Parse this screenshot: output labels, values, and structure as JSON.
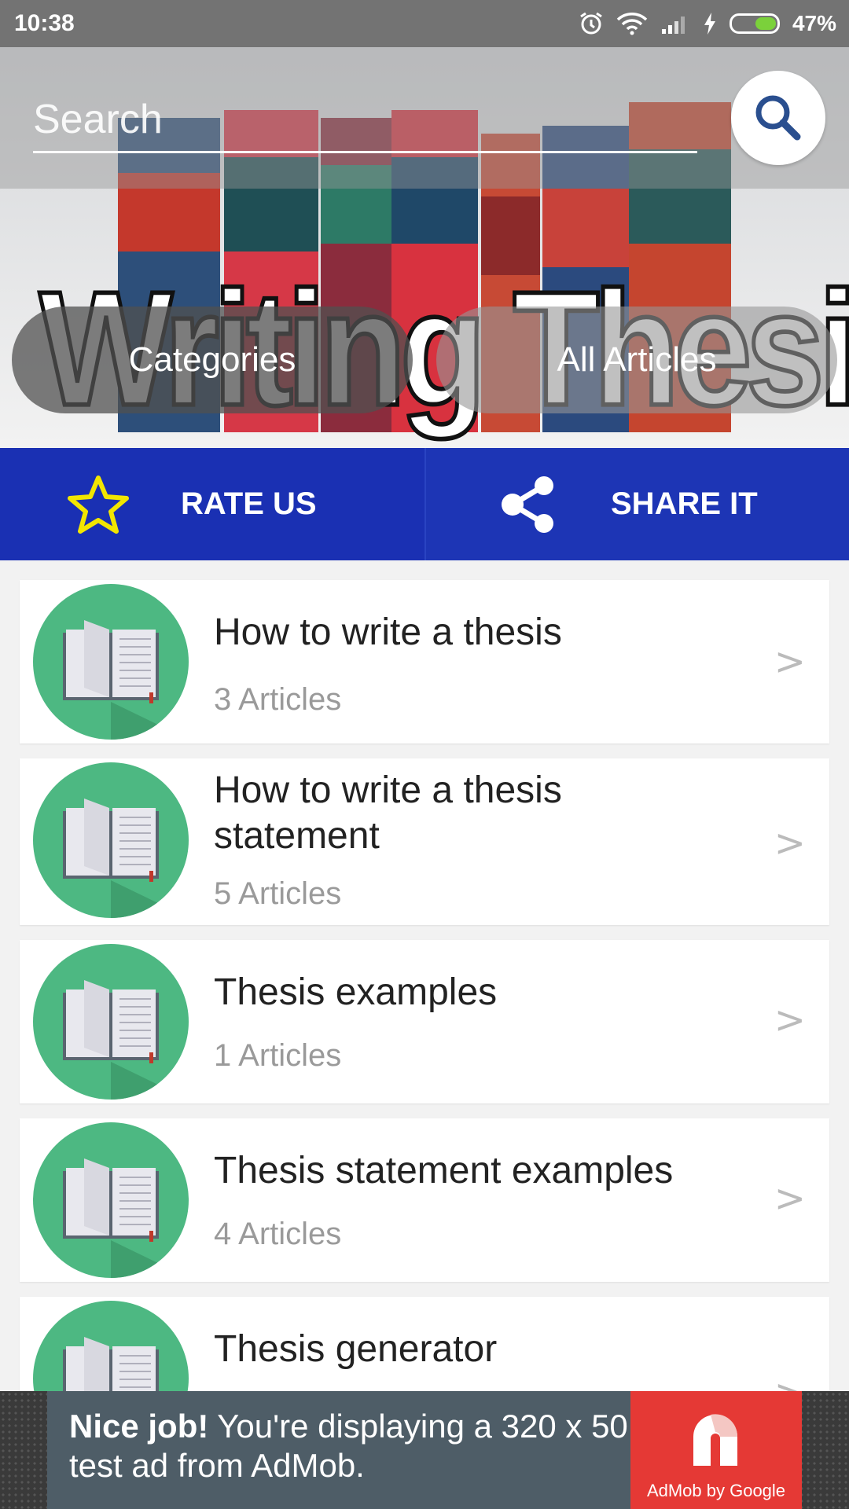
{
  "status_bar": {
    "time": "10:38",
    "battery_percent": "47%",
    "battery_level": 0.47,
    "icons": [
      "alarm-icon",
      "wifi-icon",
      "signal-icon",
      "charging-icon",
      "battery-icon"
    ]
  },
  "header": {
    "search_placeholder": "Search",
    "banner_title": "Writing Thesis",
    "categories_label": "Categories",
    "all_articles_label": "All Articles"
  },
  "actions": {
    "rate_label": "RATE US",
    "share_label": "SHARE IT"
  },
  "colors": {
    "action_bar": "#1a30b3",
    "avatar_green": "#4db882",
    "star_yellow": "#f2e600"
  },
  "categories": [
    {
      "title": "How to write a thesis",
      "count": "3 Articles"
    },
    {
      "title": "How to write a thesis statement",
      "count": "5 Articles"
    },
    {
      "title": "Thesis examples",
      "count": "1 Articles"
    },
    {
      "title": "Thesis statement examples",
      "count": "4 Articles"
    },
    {
      "title": "Thesis generator",
      "count": ""
    }
  ],
  "ad": {
    "headline": "Nice job!",
    "body": " You're displaying a 320 x 50 test ad from AdMob.",
    "logo_caption": "AdMob by Google"
  }
}
